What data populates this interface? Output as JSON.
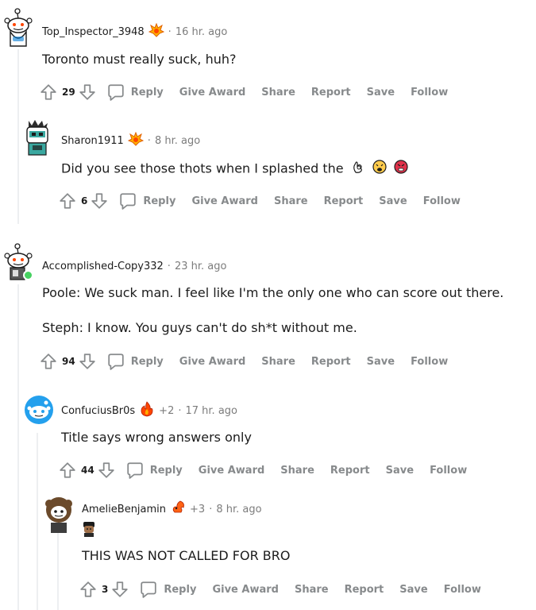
{
  "colors": {
    "text": "#1c1c1c",
    "meta": "#7c7c7c",
    "action": "#878a8c",
    "thread_line": "#edeff1",
    "online": "#46d160",
    "award_orange": "#f58220"
  },
  "comments": [
    {
      "author": "Top_Inspector_3948",
      "award_icon": "flame-award-icon",
      "time": "16 hr. ago",
      "body": [
        "Toronto must really suck, huh?"
      ],
      "score": "29",
      "actions": {
        "reply": "Reply",
        "give_award": "Give Award",
        "share": "Share",
        "report": "Report",
        "save": "Save",
        "follow": "Follow"
      }
    },
    {
      "author": "Sharon1911",
      "award_icon": "flame-award-icon",
      "time": "8 hr. ago",
      "body": [
        "Did you see those thots when I splashed the"
      ],
      "emojis": [
        "ok-hand-emoji",
        "tired-face-emoji",
        "angry-face-emoji"
      ],
      "score": "6",
      "actions": {
        "reply": "Reply",
        "give_award": "Give Award",
        "share": "Share",
        "report": "Report",
        "save": "Save",
        "follow": "Follow"
      }
    },
    {
      "author": "Accomplished-Copy332",
      "time": "23 hr. ago",
      "body": [
        "Poole: We suck man. I feel like I'm the only one who can score out there.",
        "Steph: I know. You guys can't do sh*t without me."
      ],
      "score": "94",
      "actions": {
        "reply": "Reply",
        "give_award": "Give Award",
        "share": "Share",
        "report": "Report",
        "save": "Save",
        "follow": "Follow"
      }
    },
    {
      "author": "ConfuciusBr0s",
      "award_icon": "fire-award-icon",
      "award_count": "+2",
      "time": "17 hr. ago",
      "body": [
        "Title says wrong answers only"
      ],
      "score": "44",
      "actions": {
        "reply": "Reply",
        "give_award": "Give Award",
        "share": "Share",
        "report": "Report",
        "save": "Save",
        "follow": "Follow"
      }
    },
    {
      "author": "AmelieBenjamin",
      "award_icon": "squirrel-award-icon",
      "award_count": "+3",
      "time": "8 hr. ago",
      "body": [
        "THIS WAS NOT CALLED FOR BRO"
      ],
      "score": "3",
      "actions": {
        "reply": "Reply",
        "give_award": "Give Award",
        "share": "Share",
        "report": "Report",
        "save": "Save",
        "follow": "Follow"
      }
    }
  ]
}
